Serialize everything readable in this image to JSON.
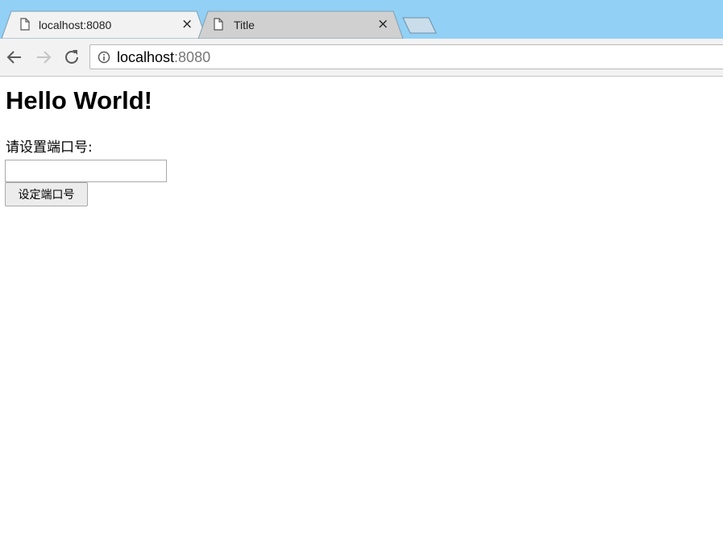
{
  "tabs": [
    {
      "title": "localhost:8080",
      "active": true
    },
    {
      "title": "Title",
      "active": false
    }
  ],
  "tab_close_glyph": "×",
  "address_bar": {
    "host": "localhost",
    "port": ":8080"
  },
  "page": {
    "heading": "Hello World!",
    "port_label": "请设置端口号:",
    "port_input_value": "",
    "set_button_label": "设定端口号"
  },
  "colors": {
    "tabstrip": "#92d0f5",
    "active_tab": "#f2f2f2",
    "inactive_tab": "#d0d0d0"
  },
  "icons": [
    "page-icon",
    "close-icon",
    "new-tab-icon",
    "back-arrow-icon",
    "forward-arrow-icon",
    "reload-icon",
    "info-icon"
  ]
}
